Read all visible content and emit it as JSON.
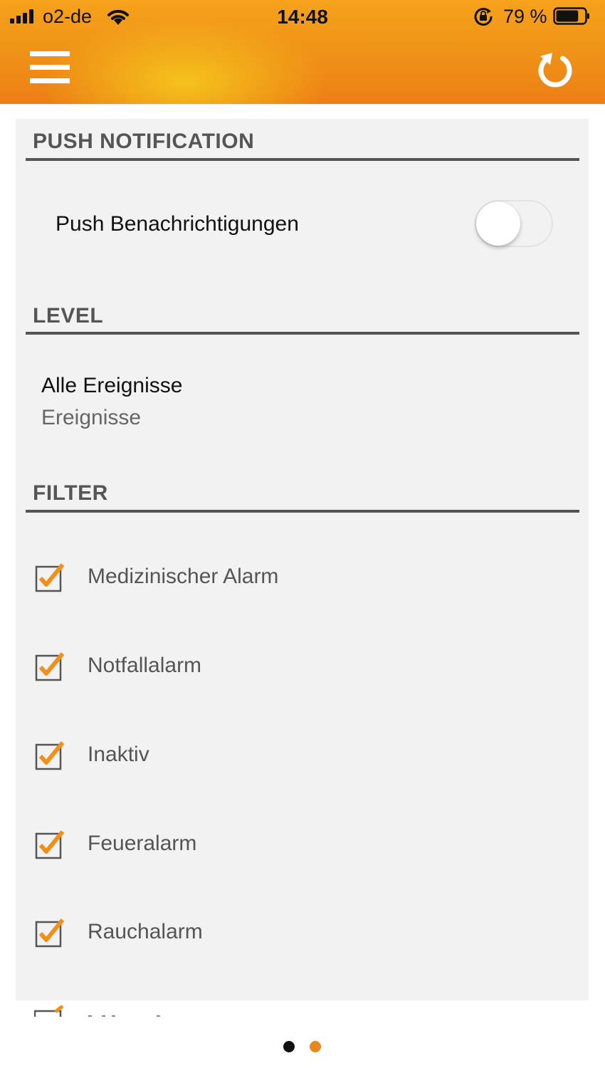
{
  "status_bar": {
    "carrier": "o2-de",
    "time": "14:48",
    "battery_percent": "79 %",
    "battery_level": 0.79
  },
  "header": {
    "menu_icon": "hamburger-menu-icon",
    "refresh_icon": "refresh-icon",
    "accent_color": "#F0901A"
  },
  "push_section": {
    "title": "PUSH NOTIFICATION",
    "toggle_label": "Push Benachrichtigungen",
    "toggle_on": false
  },
  "level_section": {
    "title": "LEVEL",
    "value": "Alle Ereignisse",
    "subtitle": "Ereignisse"
  },
  "filter_section": {
    "title": "FILTER",
    "items": [
      {
        "label": "Medizinischer Alarm",
        "checked": true
      },
      {
        "label": "Notfallalarm",
        "checked": true
      },
      {
        "label": "Inaktiv",
        "checked": true
      },
      {
        "label": "Feueralarm",
        "checked": true
      },
      {
        "label": "Rauchalarm",
        "checked": true
      }
    ]
  },
  "pagination": {
    "page_count": 2,
    "current_page": 2,
    "active_color": "#E8861F",
    "inactive_color": "#111111"
  }
}
